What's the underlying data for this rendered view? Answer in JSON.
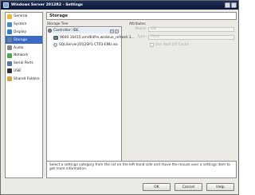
{
  "window": {
    "title": "Windows Server 2012R2 - Settings"
  },
  "sidebar": {
    "items": [
      {
        "label": "General",
        "icon": "general-icon",
        "color": "#f0b73d",
        "active": false
      },
      {
        "label": "System",
        "icon": "system-icon",
        "color": "#4b86c9",
        "active": false
      },
      {
        "label": "Display",
        "icon": "display-icon",
        "color": "#2f7fd0",
        "active": false
      },
      {
        "label": "Storage",
        "icon": "storage-icon",
        "color": "#6a7f9a",
        "active": true
      },
      {
        "label": "Audio",
        "icon": "audio-icon",
        "color": "#888888",
        "active": false
      },
      {
        "label": "Network",
        "icon": "network-icon",
        "color": "#4aa94a",
        "active": false
      },
      {
        "label": "Serial Ports",
        "icon": "serial-ports-icon",
        "color": "#5577aa",
        "active": false
      },
      {
        "label": "USB",
        "icon": "usb-icon",
        "color": "#333333",
        "active": false
      },
      {
        "label": "Shared Folders",
        "icon": "shared-folders-icon",
        "color": "#d7a540",
        "active": false
      }
    ]
  },
  "page": {
    "title": "Storage"
  },
  "storage_tree": {
    "label": "Storage Tree",
    "controller": "Controller: IDE",
    "items": [
      {
        "label": "9600.16415.amd64fre.winblue_refresh.1...",
        "icon": "hard-disk-icon"
      },
      {
        "label": "SQLServer2012SP1-CTP3-ENU.iso",
        "icon": "optical-disk-icon"
      }
    ]
  },
  "attributes": {
    "label": "Attributes",
    "name_label": "Name:",
    "name_value": "IDE",
    "type_label": "Type:",
    "type_value": "PIIX4",
    "cache_label": "Use Host I/O Cache"
  },
  "info_text": "Select a settings category from the list on the left-hand side and move the mouse over a settings item to get more information.",
  "buttons": {
    "ok": "OK",
    "cancel": "Cancel",
    "help": "Help"
  },
  "colors": {
    "selection": "#3b6ac4",
    "titlebar": "#1e2f57"
  }
}
